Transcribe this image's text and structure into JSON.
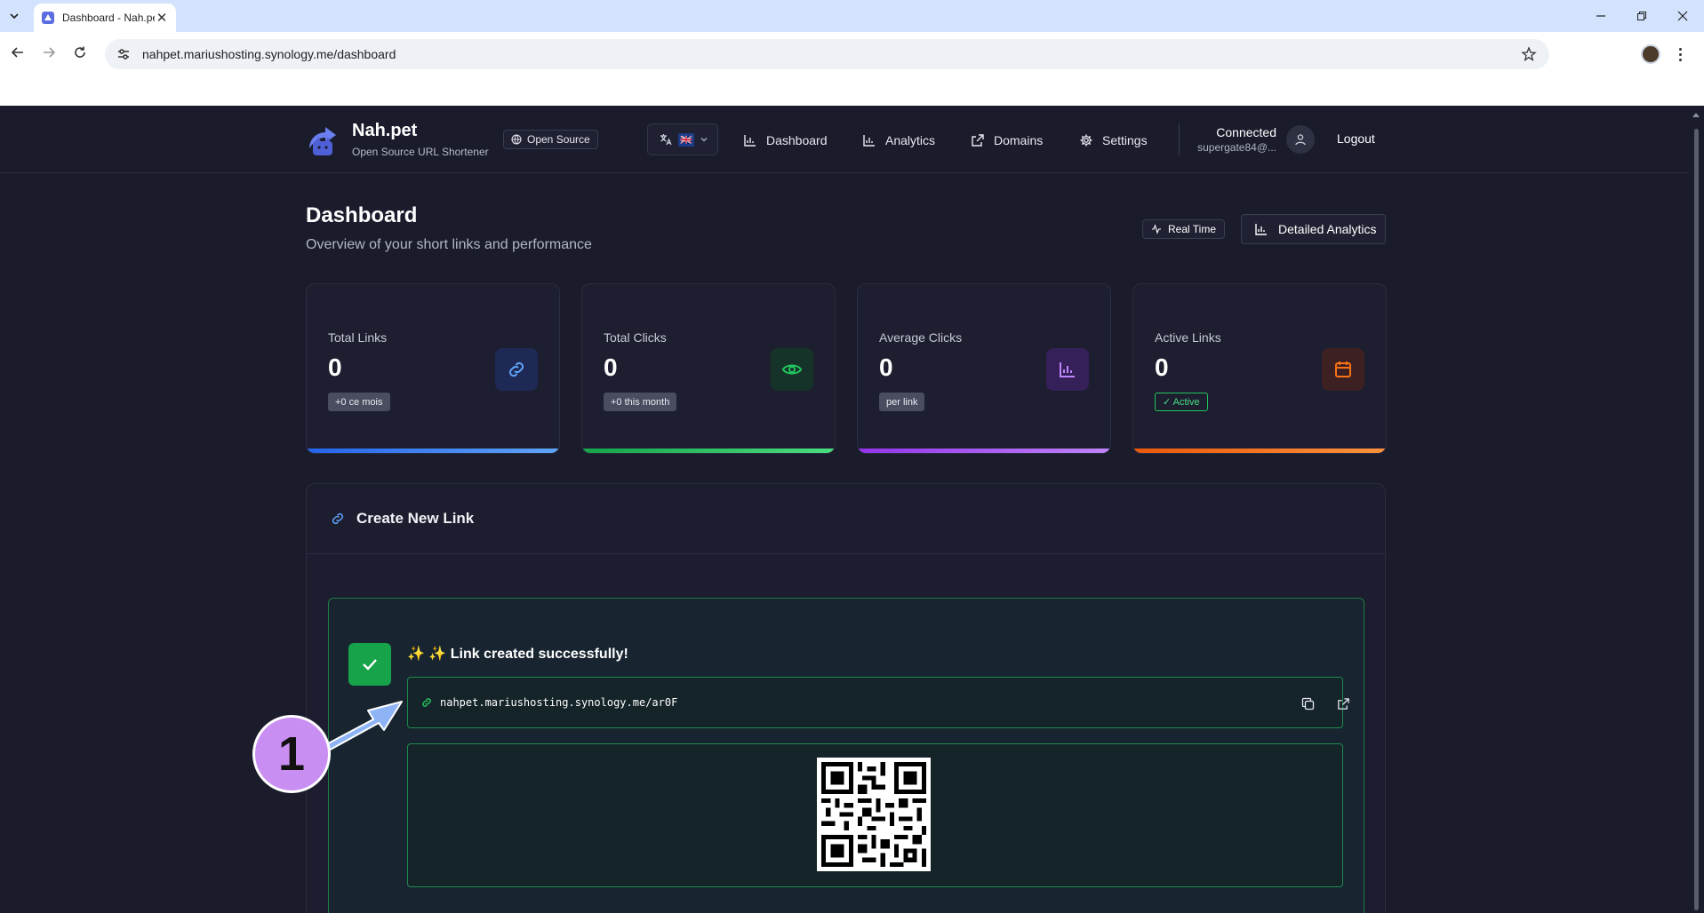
{
  "browser": {
    "tab_title": "Dashboard - Nah.pet",
    "url": "nahpet.mariushosting.synology.me/dashboard"
  },
  "header": {
    "brand": "Nah.pet",
    "tagline": "Open Source URL Shortener",
    "open_source_label": "Open Source",
    "language_flag": "🇬🇧",
    "nav": [
      {
        "label": "Dashboard",
        "icon": "bar-chart-icon"
      },
      {
        "label": "Analytics",
        "icon": "bar-chart-icon"
      },
      {
        "label": "Domains",
        "icon": "external-link-icon"
      },
      {
        "label": "Settings",
        "icon": "gear-icon"
      }
    ],
    "connected_label": "Connected",
    "user_email": "supergate84@...",
    "logout_label": "Logout"
  },
  "page": {
    "title": "Dashboard",
    "subtitle": "Overview of your short links and performance",
    "real_time_label": "Real Time",
    "detailed_analytics_label": "Detailed Analytics"
  },
  "stats": [
    {
      "label": "Total Links",
      "value": "0",
      "tag": "+0 ce mois",
      "icon": "link-icon",
      "accent": "#3b82f6"
    },
    {
      "label": "Total Clicks",
      "value": "0",
      "tag": "+0 this month",
      "icon": "eye-icon",
      "accent": "#22c55e"
    },
    {
      "label": "Average Clicks",
      "value": "0",
      "tag": "per link",
      "icon": "bar-chart-icon",
      "accent": "#a855f7"
    },
    {
      "label": "Active Links",
      "value": "0",
      "tag": "✓ Active",
      "icon": "calendar-icon",
      "accent": "#f97316"
    }
  ],
  "create": {
    "title": "Create New Link",
    "success_message": "✨ ✨ Link created successfully!",
    "short_url": "nahpet.mariushosting.synology.me/ar0F"
  },
  "annotation": {
    "step_number": "1"
  },
  "colors": {
    "background": "#1a1b2b",
    "success_green": "#16a34a"
  }
}
